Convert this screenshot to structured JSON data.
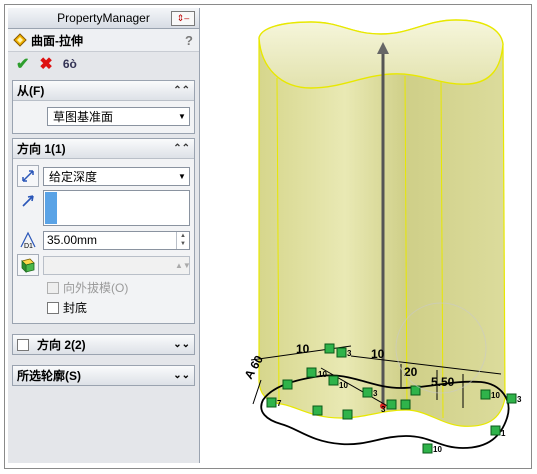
{
  "panel": {
    "title": "PropertyManager",
    "pin_icon": "pin-icon",
    "feature_icon": "surface-extrude-icon",
    "feature_name": "曲面-拉伸",
    "help_label": "?",
    "actions": {
      "ok_icon": "checkmark-icon",
      "cancel_icon": "x-icon",
      "preview_icon": "glasses-icon",
      "ok": "✔",
      "cancel": "✖",
      "preview": "6ò"
    }
  },
  "from": {
    "header": "从(F)",
    "value": "草图基准面"
  },
  "direction1": {
    "header": "方向 1(1)",
    "end_condition": "给定深度",
    "depth": "35.00mm",
    "draft_outward_label": "向外拔模(O)",
    "cap_end_label": "封底",
    "icons": [
      "reverse-direction-icon",
      "direction-arrow-icon",
      "depth-dimension-icon",
      "draft-icon"
    ],
    "depth_icon_label": "D1"
  },
  "direction2": {
    "header": "方向 2(2)"
  },
  "contours": {
    "header": "所选轮廓(S)"
  },
  "viewport": {
    "dimension_labels": [
      "A 60",
      "10",
      "10",
      "20",
      "5.50"
    ],
    "relation_labels": [
      "10",
      "3",
      "10",
      "3",
      "7",
      "3",
      "10",
      "10",
      "3",
      "1"
    ],
    "colors": {
      "surface": "#dede9a",
      "edge": "#e8e800",
      "sketch": "#000000",
      "relation": "#1a8a2a"
    }
  }
}
